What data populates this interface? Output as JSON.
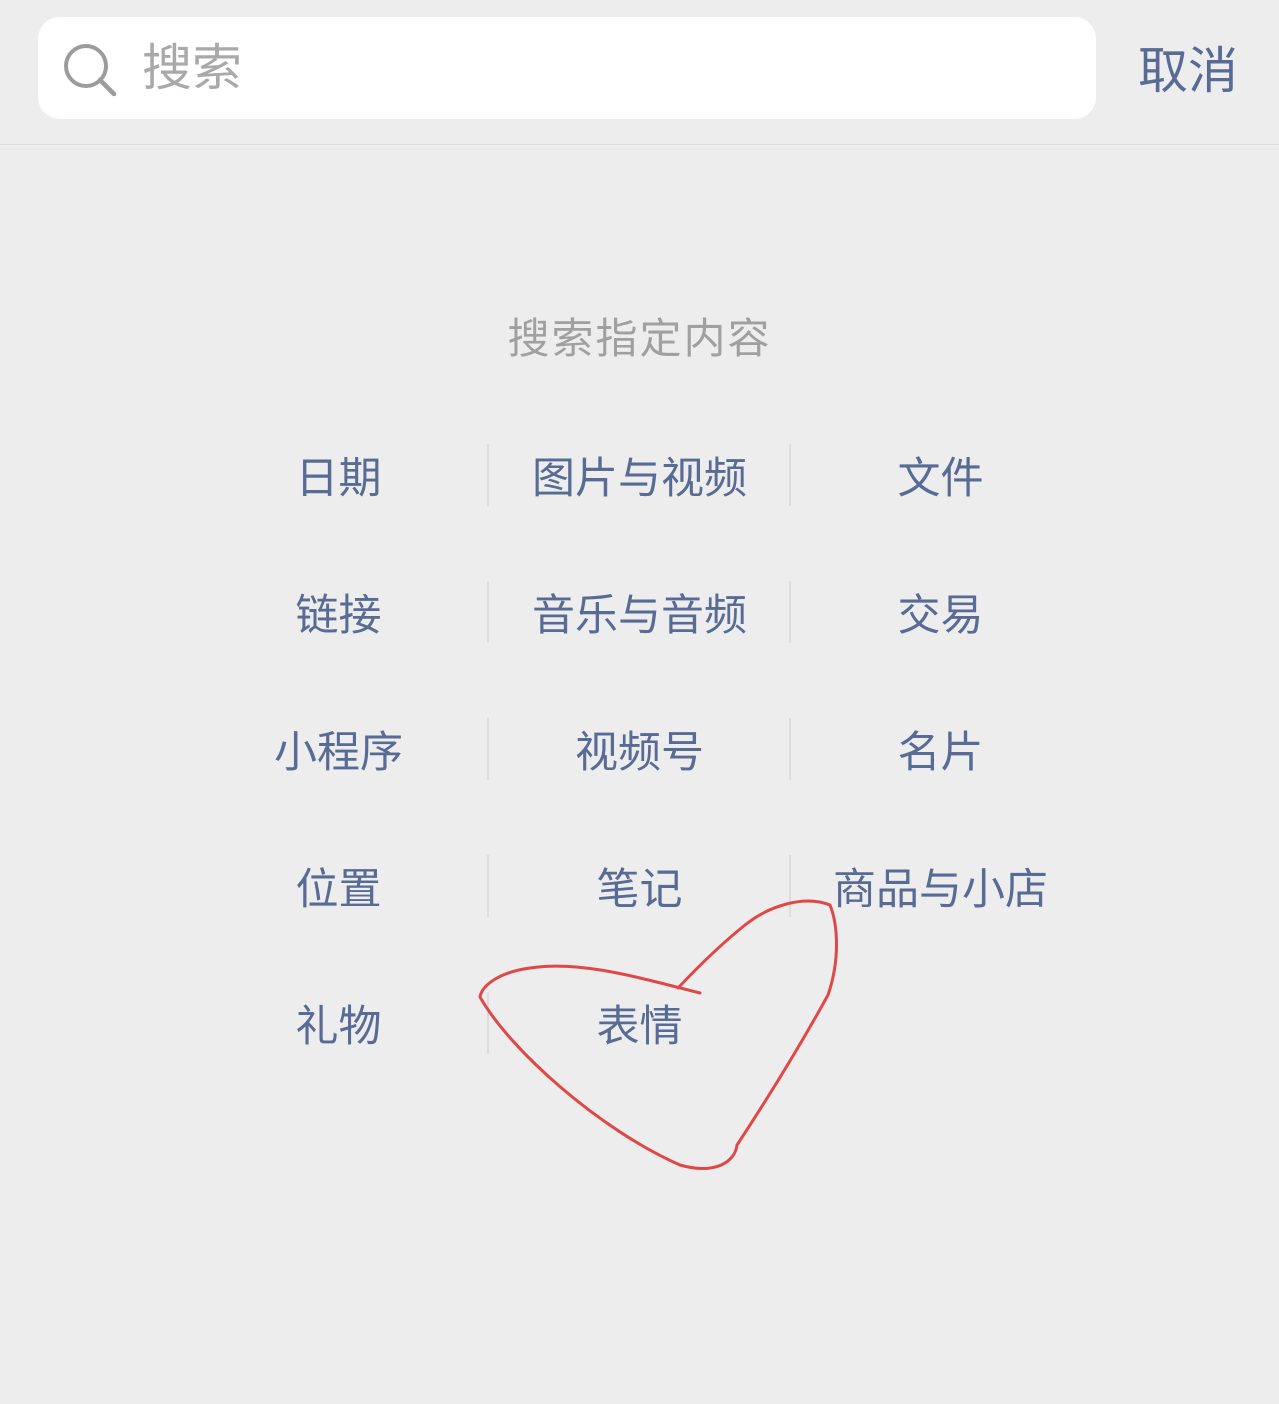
{
  "search": {
    "placeholder": "搜索",
    "value": ""
  },
  "cancel_label": "取消",
  "section_title": "搜索指定内容",
  "categories": [
    [
      "日期",
      "图片与视频",
      "文件"
    ],
    [
      "链接",
      "音乐与音频",
      "交易"
    ],
    [
      "小程序",
      "视频号",
      "名片"
    ],
    [
      "位置",
      "笔记",
      "商品与小店"
    ],
    [
      "礼物",
      "表情",
      ""
    ]
  ],
  "colors": {
    "background": "#ededed",
    "link": "#576b95",
    "placeholder": "#a9a9a9",
    "annotation": "#e04848"
  },
  "icons": {
    "search": "search-icon"
  }
}
